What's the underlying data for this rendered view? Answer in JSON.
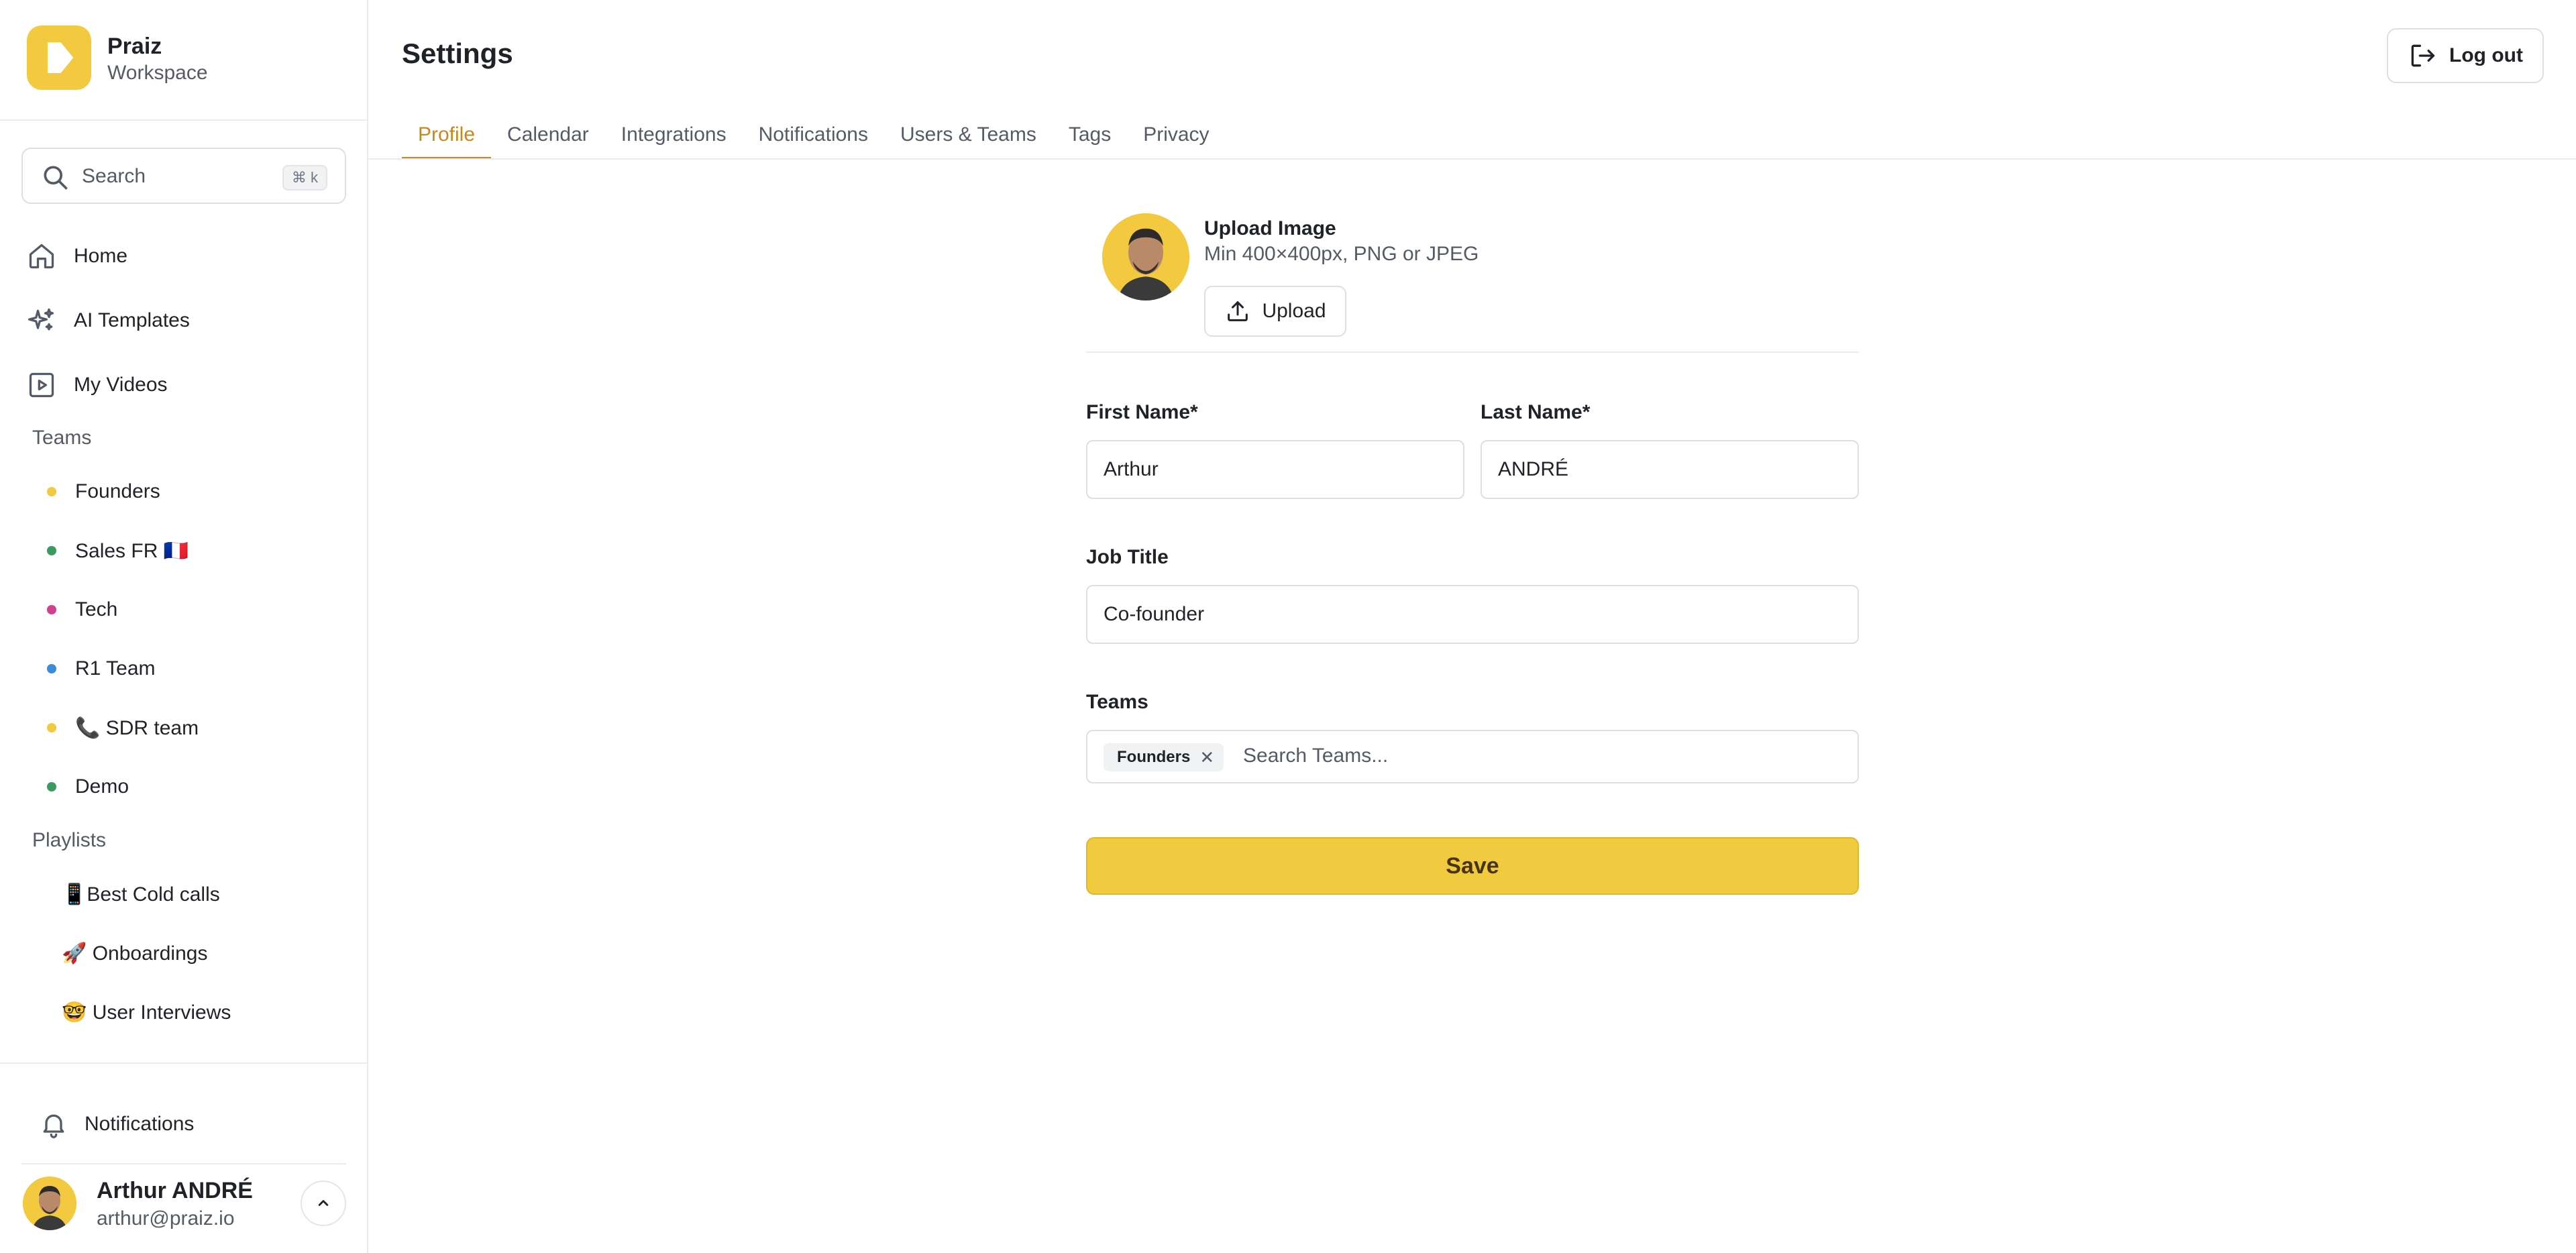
{
  "workspace": {
    "name": "Praiz",
    "subtitle": "Workspace"
  },
  "search": {
    "label": "Search",
    "shortcut": "⌘ k"
  },
  "nav": [
    {
      "label": "Home",
      "icon": "home-icon"
    },
    {
      "label": "AI Templates",
      "icon": "sparkles-icon"
    },
    {
      "label": "My Videos",
      "icon": "video-icon"
    }
  ],
  "teams_section": {
    "title": "Teams",
    "items": [
      {
        "label": "Founders",
        "color": "#f3c93f"
      },
      {
        "label": "Sales FR 🇫🇷",
        "color": "#3b9b5f"
      },
      {
        "label": "Tech",
        "color": "#d23f8c"
      },
      {
        "label": "R1 Team",
        "color": "#3c8bd9"
      },
      {
        "label": "📞 SDR team",
        "color": "#f3c93f"
      },
      {
        "label": "Demo",
        "color": "#3b9b5f"
      }
    ]
  },
  "playlists_section": {
    "title": "Playlists",
    "items": [
      {
        "label": "📱Best Cold calls"
      },
      {
        "label": "🚀 Onboardings"
      },
      {
        "label": "🤓 User Interviews"
      }
    ]
  },
  "sidebar_bottom": {
    "notifications_label": "Notifications"
  },
  "user": {
    "name": "Arthur ANDRÉ",
    "email": "arthur@praiz.io"
  },
  "header": {
    "title": "Settings",
    "logout_label": "Log out"
  },
  "tabs": [
    {
      "label": "Profile",
      "active": true
    },
    {
      "label": "Calendar"
    },
    {
      "label": "Integrations"
    },
    {
      "label": "Notifications"
    },
    {
      "label": "Users & Teams"
    },
    {
      "label": "Tags"
    },
    {
      "label": "Privacy"
    }
  ],
  "profile": {
    "upload_title": "Upload Image",
    "upload_hint": "Min 400×400px, PNG or JPEG",
    "upload_button": "Upload",
    "first_name_label": "First Name*",
    "first_name_value": "Arthur",
    "last_name_label": "Last Name*",
    "last_name_value": "ANDRÉ",
    "job_title_label": "Job Title",
    "job_title_value": "Co-founder",
    "teams_label": "Teams",
    "teams_chips": [
      "Founders"
    ],
    "teams_placeholder": "Search Teams...",
    "save_label": "Save"
  },
  "colors": {
    "accent": "#c8891c",
    "brand": "#f3c93f"
  }
}
